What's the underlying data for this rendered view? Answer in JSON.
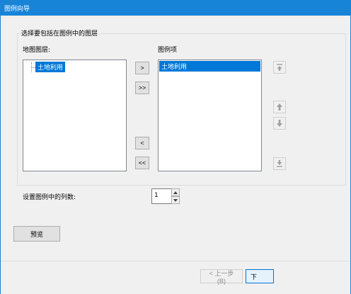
{
  "window": {
    "title": "图例向导"
  },
  "group": {
    "label": "选择要包括在图例中的图层"
  },
  "map_layers": {
    "label": "地图图层:",
    "items": [
      "土地利用"
    ]
  },
  "legend_items": {
    "label": "图例项",
    "items": [
      "土地利用"
    ]
  },
  "transfer_buttons": {
    "add_one": ">",
    "add_all": ">>",
    "remove_one": "<",
    "remove_all": "<<"
  },
  "order_buttons": {
    "move_top": "move-to-top-icon",
    "move_up": "arrow-up-icon",
    "move_down": "arrow-down-icon",
    "move_bottom": "move-to-bottom-icon"
  },
  "columns": {
    "label": "设置图例中的列数:",
    "value": "1"
  },
  "preview_button": "预览",
  "nav": {
    "back": "< 上一步(B)",
    "next": "下"
  },
  "colors": {
    "titlebar": "#1884d8",
    "selection": "#0078d7",
    "dialog_bg": "#f0f0f0"
  }
}
